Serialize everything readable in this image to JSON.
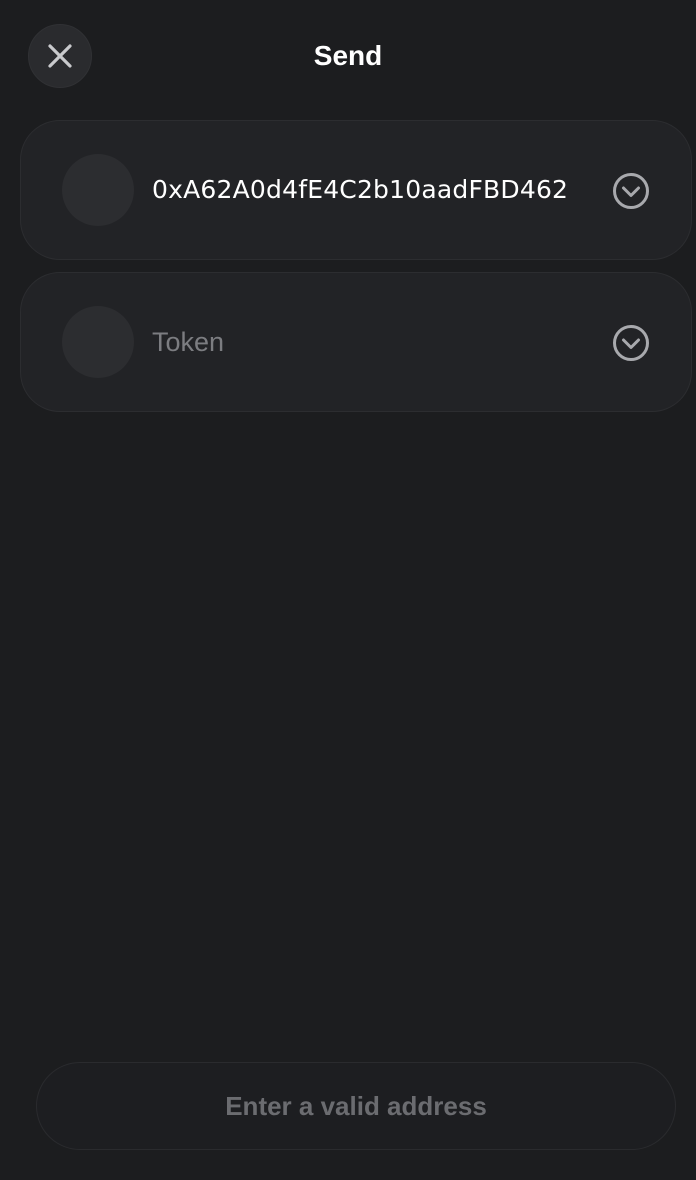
{
  "header": {
    "title": "Send",
    "close_icon": "close-icon"
  },
  "recipient": {
    "address": "0xA62A0d4fE4C2b10aadFBD462",
    "expand_icon": "chevron-down-circle-icon"
  },
  "token": {
    "placeholder": "Token",
    "expand_icon": "chevron-down-circle-icon"
  },
  "footer": {
    "submit_label": "Enter a valid address"
  },
  "colors": {
    "background": "#1c1d1f",
    "card": "#222326",
    "muted_text": "#7c7d81",
    "disabled_text": "#6b6c70"
  }
}
